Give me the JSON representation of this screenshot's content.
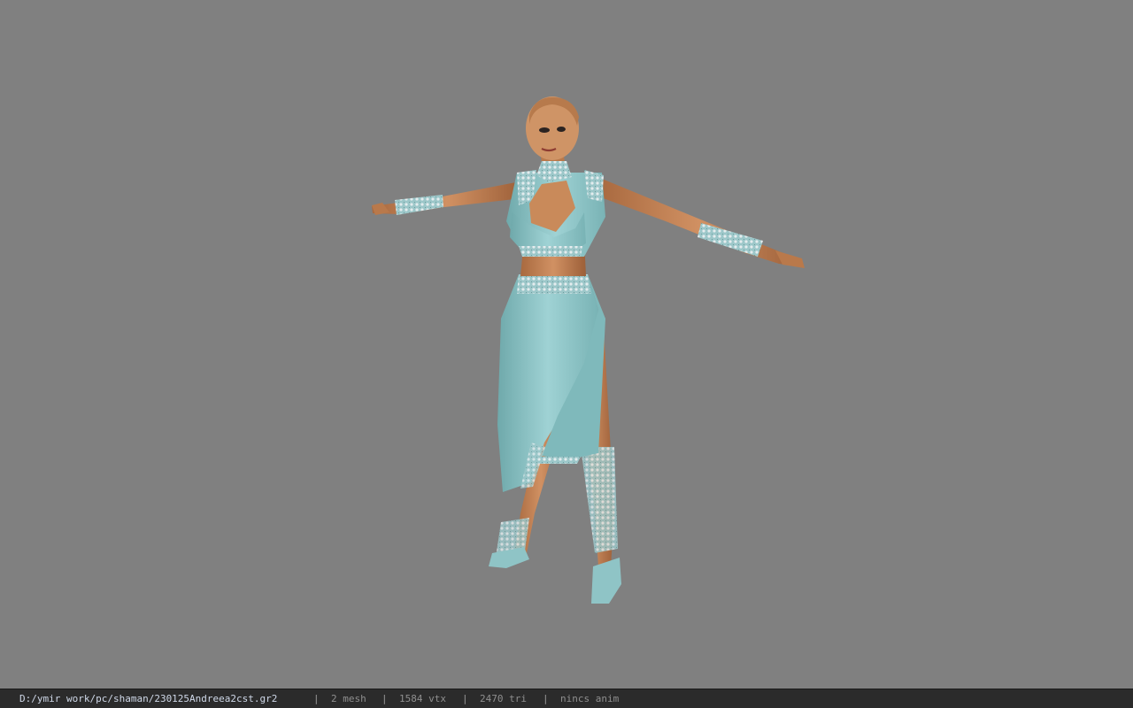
{
  "viewer": {
    "background_color": "#808080"
  },
  "model": {
    "skin_color": "#c98a5a",
    "dress_color": "#8fc4c6",
    "lace_color": "#d9e0e2"
  },
  "status_bar": {
    "file_path": "D:/ymir work/pc/shaman/230125Andreea2cst.gr2",
    "separator": "|",
    "mesh_count": "2 mesh",
    "vertex_count": "1584 vtx",
    "triangle_count": "2470 tri",
    "anim_status": "nincs anim"
  }
}
